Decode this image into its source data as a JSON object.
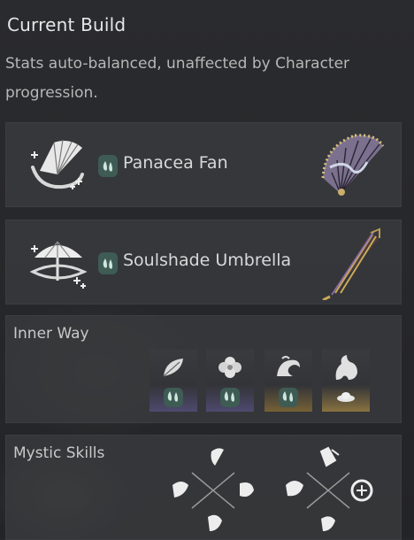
{
  "panel": {
    "title": "Current Build",
    "description": "Stats auto-balanced, unaffected by Character progression."
  },
  "weapons": [
    {
      "name": "Panacea Fan",
      "icon": "fan-icon",
      "art": "fan-weapon-art"
    },
    {
      "name": "Soulshade Umbrella",
      "icon": "umbrella-icon",
      "art": "umbrella-weapon-art"
    }
  ],
  "inner_way": {
    "label": "Inner Way",
    "slots": [
      {
        "icon": "leaf-icon",
        "glow": "#6a5fa0"
      },
      {
        "icon": "flower-icon",
        "glow": "#6a5fa0"
      },
      {
        "icon": "wave-icon",
        "glow": "#b08a3a"
      },
      {
        "icon": "beast-icon",
        "glow": "#c4a04a"
      }
    ]
  },
  "mystic": {
    "label": "Mystic Skills",
    "clusters": [
      {
        "icon": "mystic-skill-cluster-1"
      },
      {
        "icon": "mystic-skill-cluster-2"
      }
    ]
  },
  "colors": {
    "tag_green": "#3e5b54",
    "purple_glow": "#6a5fa0",
    "gold_glow": "#c4a04a"
  }
}
